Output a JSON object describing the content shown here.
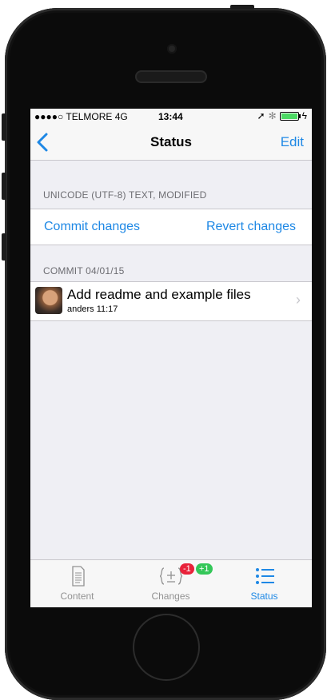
{
  "status_bar": {
    "carrier": "●●●●○ TELMORE  4G",
    "time": "13:44",
    "location_glyph": "➚",
    "bluetooth_glyph": "✻"
  },
  "nav": {
    "back_glyph": "<",
    "title": "Status",
    "edit_label": "Edit"
  },
  "sections": {
    "file_header": "UNICODE (UTF-8) TEXT, MODIFIED",
    "commit_changes_label": "Commit changes",
    "revert_changes_label": "Revert changes",
    "commit_header": "COMMIT 04/01/15"
  },
  "commit": {
    "message": "Add readme and example files",
    "meta": "anders 11:17",
    "chevron": "›"
  },
  "tabs": [
    {
      "label": "Content",
      "icon": "document-icon"
    },
    {
      "label": "Changes",
      "icon": "plus-minus-icon",
      "badges": [
        "-1",
        "+1"
      ]
    },
    {
      "label": "Status",
      "icon": "list-icon"
    }
  ],
  "colors": {
    "accent": "#1e88e5",
    "badge_red": "#e8223a",
    "badge_green": "#34c759"
  }
}
